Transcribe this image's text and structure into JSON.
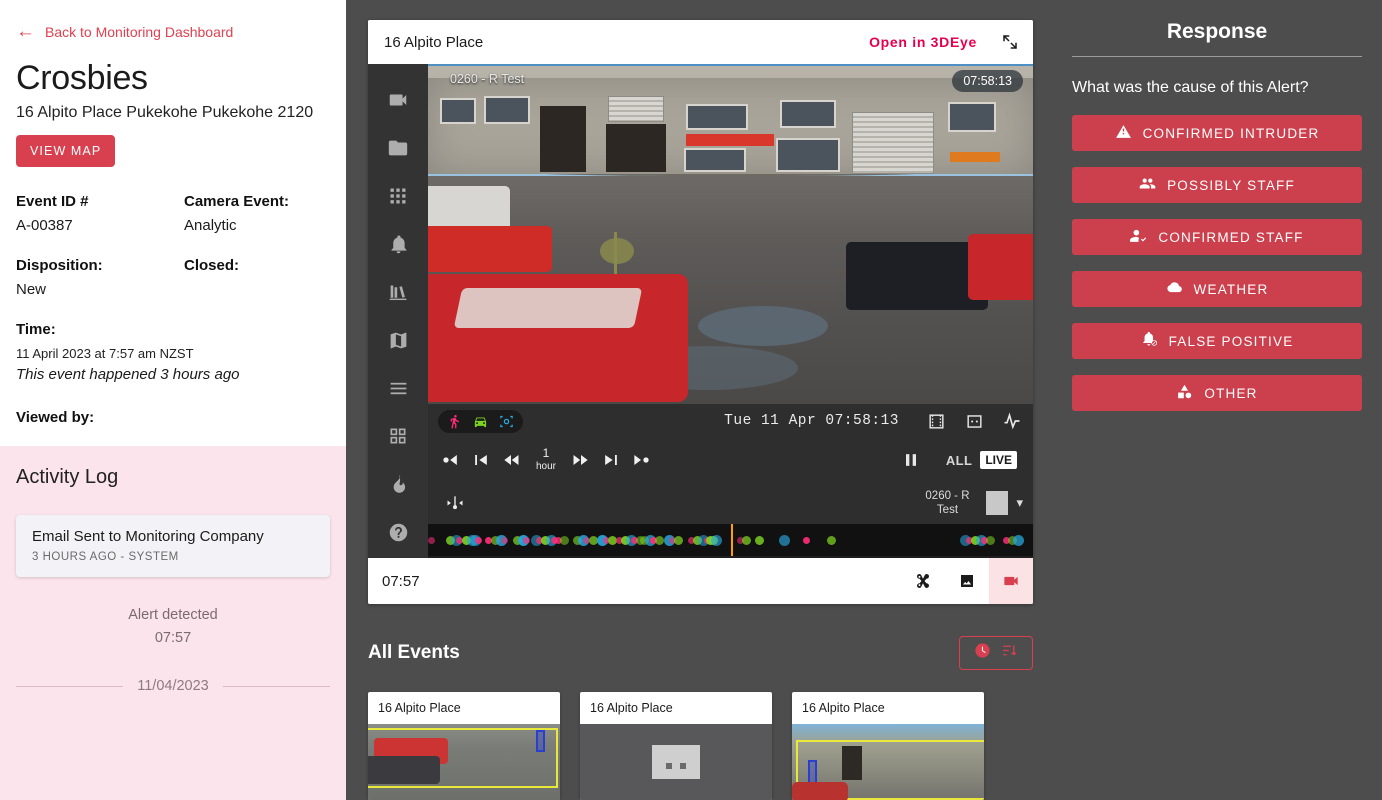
{
  "sidebar": {
    "back_link": "Back to Monitoring Dashboard",
    "site_name": "Crosbies",
    "site_address": "16 Alpito Place Pukekohe Pukekohe 2120",
    "view_map_label": "VIEW MAP",
    "event_id_label": "Event ID #",
    "event_id_value": "A-00387",
    "camera_event_label": "Camera Event:",
    "camera_event_value": "Analytic",
    "disposition_label": "Disposition:",
    "disposition_value": "New",
    "closed_label": "Closed:",
    "closed_value": "",
    "time_label": "Time:",
    "time_value": "11 April 2023 at 7:57 am NZST",
    "time_relative": "This event happened 3 hours ago",
    "viewed_by_label": "Viewed by:"
  },
  "activity": {
    "title": "Activity Log",
    "entries": [
      {
        "title": "Email Sent to Monitoring Company",
        "meta": "3 HOURS AGO - SYSTEM"
      }
    ],
    "alert_text": "Alert detected",
    "alert_time": "07:57",
    "date_divider": "11/04/2023"
  },
  "player": {
    "header_title": "16 Alpito Place",
    "open_link": "Open in 3DEye",
    "overlay_camera_label": "0260 - R Test",
    "overlay_timestamp": "07:58:13",
    "status_timestamp": "Tue 11 Apr 07:58:13",
    "step_label_top": "1",
    "step_label_bottom": "hour",
    "all_label": "ALL",
    "live_label": "LIVE",
    "camera_selector": "0260 - R Test",
    "footer_time": "07:57",
    "tools": [
      {
        "name": "video-camera-icon"
      },
      {
        "name": "folder-icon"
      },
      {
        "name": "apps-grid-icon"
      },
      {
        "name": "bell-icon"
      },
      {
        "name": "library-icon"
      },
      {
        "name": "map-icon"
      },
      {
        "name": "menu-icon"
      },
      {
        "name": "grid-squares-icon"
      },
      {
        "name": "flame-icon"
      },
      {
        "name": "help-icon"
      }
    ],
    "filter_chips": [
      {
        "name": "person-filter-icon",
        "color": "#ff2d78"
      },
      {
        "name": "vehicle-filter-icon",
        "color": "#7ed321"
      },
      {
        "name": "object-filter-icon",
        "color": "#29a8e0"
      }
    ]
  },
  "events": {
    "section_title": "All Events",
    "sort_clock_icon": "clock-icon",
    "sort_order_icon": "sort-descending-icon",
    "cards": [
      {
        "label": "16 Alpito Place"
      },
      {
        "label": "16 Alpito Place"
      },
      {
        "label": "16 Alpito Place"
      }
    ]
  },
  "response": {
    "title": "Response",
    "question": "What was the cause of this Alert?",
    "accent_color": "#cc3f4c",
    "buttons": [
      {
        "label": "CONFIRMED INTRUDER",
        "icon": "warning-triangle-icon"
      },
      {
        "label": "POSSIBLY STAFF",
        "icon": "people-icon"
      },
      {
        "label": "CONFIRMED STAFF",
        "icon": "person-check-icon"
      },
      {
        "label": "WEATHER",
        "icon": "cloud-icon"
      },
      {
        "label": "FALSE POSITIVE",
        "icon": "bell-off-icon"
      },
      {
        "label": "OTHER",
        "icon": "shapes-icon"
      }
    ]
  },
  "timeline": {
    "playhead_percent": 50,
    "marker_colors": [
      "#ff2d78",
      "#7ed321",
      "#29a8e0"
    ]
  }
}
